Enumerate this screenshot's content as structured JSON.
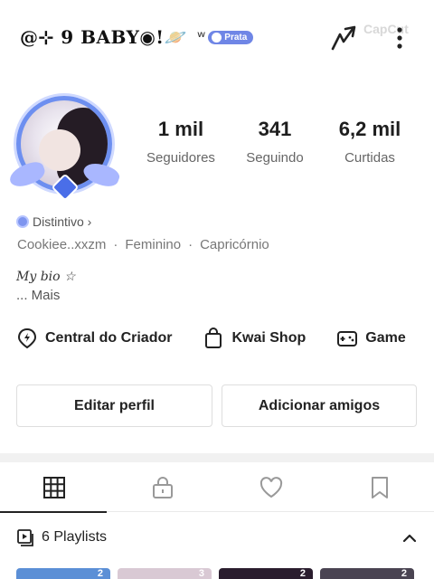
{
  "header": {
    "username": "@⊹ 9 BABY◉!🪐",
    "wave": "ʷ",
    "badge_label": "Prata",
    "watermark": "CapCut"
  },
  "profile": {
    "stats": [
      {
        "value": "1 mil",
        "label": "Seguidores"
      },
      {
        "value": "341",
        "label": "Seguindo"
      },
      {
        "value": "6,2 mil",
        "label": "Curtidas"
      }
    ],
    "distintivo": "Distintivo ›",
    "meta": [
      "Cookiee..xxzm",
      "·",
      "Feminino",
      "·",
      "Capricórnio"
    ],
    "bio": "My bio ☆",
    "more": "...  Mais"
  },
  "tools": [
    {
      "label": "Central do Criador",
      "icon": "bolt-pin-icon"
    },
    {
      "label": "Kwai Shop",
      "icon": "shopping-bag-icon"
    },
    {
      "label": "Game",
      "icon": "gamepad-icon"
    }
  ],
  "actions": {
    "edit_label": "Editar perfil",
    "add_label": "Adicionar amigos"
  },
  "tabs": [
    {
      "name": "grid",
      "icon": "grid-icon",
      "active": true
    },
    {
      "name": "private",
      "icon": "lock-icon",
      "active": false
    },
    {
      "name": "likes",
      "icon": "heart-icon",
      "active": false
    },
    {
      "name": "saved",
      "icon": "bookmark-icon",
      "active": false
    }
  ],
  "playlists": {
    "label": "6 Playlists",
    "thumbs": [
      {
        "count": "2",
        "color": "#5b8fd6"
      },
      {
        "count": "3",
        "color": "#d9c9d4"
      },
      {
        "count": "2",
        "color": "#2a1d2e"
      },
      {
        "count": "2",
        "color": "#4a4452"
      }
    ]
  },
  "colors": {
    "accent_blue": "#6f86e6",
    "text_dark": "#222222",
    "text_muted": "#777777"
  }
}
